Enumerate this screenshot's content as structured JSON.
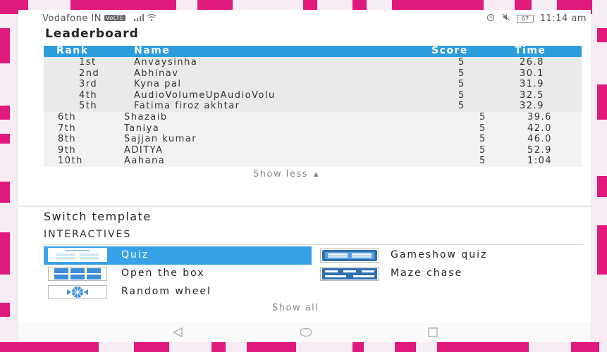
{
  "status_bar": {
    "carrier": "Vodafone IN",
    "volte": "VoLTE",
    "battery": "67",
    "time": "11:14 am"
  },
  "leaderboard": {
    "title": "Leaderboard",
    "columns": {
      "rank": "Rank",
      "name": "Name",
      "score": "Score",
      "time": "Time"
    },
    "rows": [
      {
        "rank": "1st",
        "name": "Anvaysinha",
        "score": "5",
        "time": "26.8"
      },
      {
        "rank": "2nd",
        "name": "Abhinav",
        "score": "5",
        "time": "30.1"
      },
      {
        "rank": "3rd",
        "name": "Kyna pal",
        "score": "5",
        "time": "31.9"
      },
      {
        "rank": "4th",
        "name": "AudioVolumeUpAudioVolu",
        "score": "5",
        "time": "32.5"
      },
      {
        "rank": "5th",
        "name": "Fatima firoz akhtar",
        "score": "5",
        "time": "32.9"
      },
      {
        "rank": "6th",
        "name": "Shazaib",
        "score": "5",
        "time": "39.6"
      },
      {
        "rank": "7th",
        "name": "Taniya",
        "score": "5",
        "time": "42.0"
      },
      {
        "rank": "8th",
        "name": "Sajjan kumar",
        "score": "5",
        "time": "46.0"
      },
      {
        "rank": "9th",
        "name": "ADITYA",
        "score": "5",
        "time": "52.9"
      },
      {
        "rank": "10th",
        "name": "Aahana",
        "score": "5",
        "time": "1:04"
      }
    ],
    "show_less": "Show less"
  },
  "switch_template": {
    "title": "Switch template",
    "section": "INTERACTIVES",
    "templates": {
      "quiz": "Quiz",
      "gameshow": "Gameshow quiz",
      "open_box": "Open the box",
      "maze": "Maze chase",
      "wheel": "Random wheel"
    },
    "selected": "quiz",
    "show_all": "Show all"
  },
  "icons": {
    "signal": "signal-icon",
    "wifi": "wifi-icon",
    "alarm": "alarm-icon",
    "mute": "mute-icon",
    "battery": "battery-icon",
    "caret_up": "caret-up-icon",
    "nav_back": "back-icon",
    "nav_home": "home-icon",
    "nav_recents": "recents-icon"
  },
  "colors": {
    "accent": "#2d9cdb",
    "selected": "#37a2e8",
    "frame": "#e0197d"
  }
}
